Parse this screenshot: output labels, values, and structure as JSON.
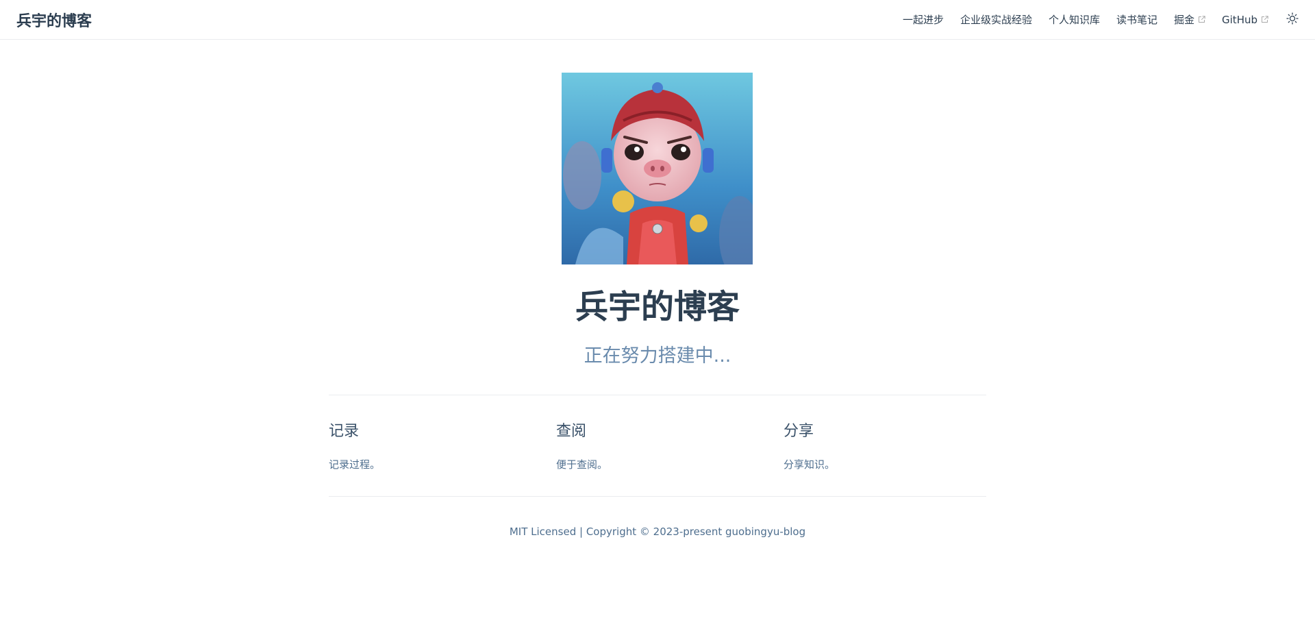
{
  "navbar": {
    "site_name": "兵宇的博客",
    "links": [
      {
        "label": "一起进步",
        "external": false
      },
      {
        "label": "企业级实战经验",
        "external": false
      },
      {
        "label": "个人知识库",
        "external": false
      },
      {
        "label": "读书笔记",
        "external": false
      },
      {
        "label": "掘金",
        "external": true
      },
      {
        "label": "GitHub",
        "external": true
      }
    ],
    "theme_icon": "sun-icon"
  },
  "hero": {
    "title": "兵宇的博客",
    "description": "正在努力搭建中..."
  },
  "features": [
    {
      "title": "记录",
      "details": "记录过程。"
    },
    {
      "title": "查阅",
      "details": "便于查阅。"
    },
    {
      "title": "分享",
      "details": "分享知识。"
    }
  ],
  "footer": {
    "text": "MIT Licensed | Copyright © 2023-present guobingyu-blog"
  },
  "colors": {
    "text": "#2c3e50",
    "description": "#6a8bad",
    "border": "#eaecef"
  }
}
